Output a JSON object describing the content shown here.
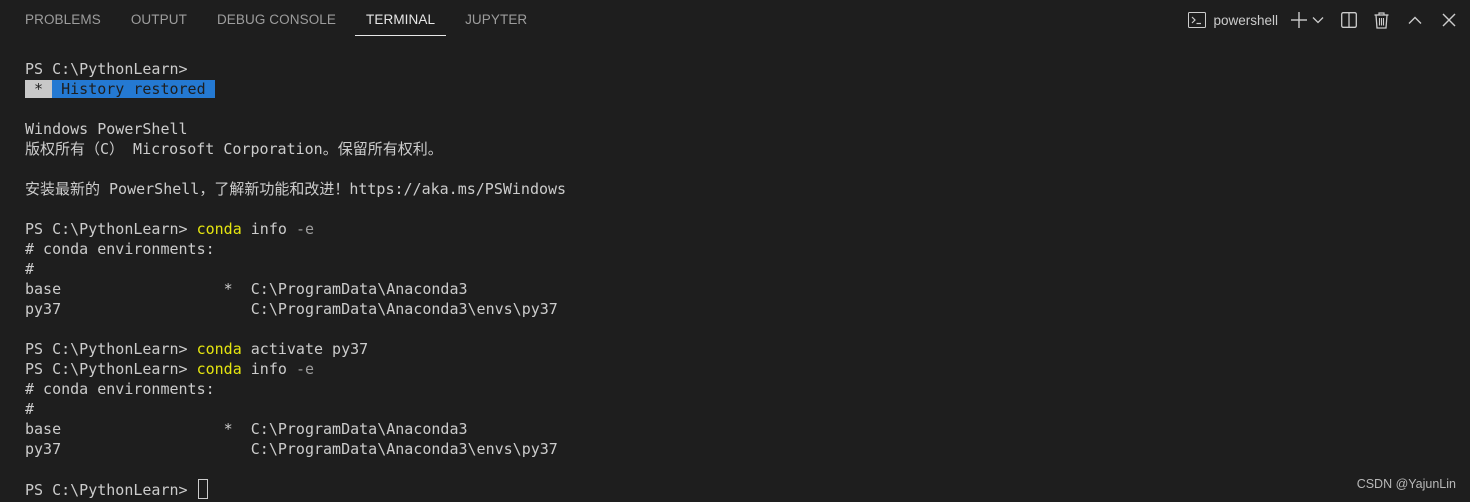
{
  "panel": {
    "tabs": [
      {
        "label": "PROBLEMS",
        "active": false
      },
      {
        "label": "OUTPUT",
        "active": false
      },
      {
        "label": "DEBUG CONSOLE",
        "active": false
      },
      {
        "label": "TERMINAL",
        "active": true
      },
      {
        "label": "JUPYTER",
        "active": false
      }
    ],
    "actions": {
      "shell_name": "powershell",
      "icons": [
        "terminal-icon",
        "plus-icon",
        "chevron-down-icon",
        "split-icon",
        "trash-icon",
        "chevron-up-icon",
        "close-icon"
      ]
    }
  },
  "terminal": {
    "lines": {
      "l01": {
        "prompt": "PS C:\\PythonLearn>"
      },
      "l02": {
        "star": " * ",
        "message": " History restored "
      },
      "l04": {
        "text": "Windows PowerShell"
      },
      "l05": {
        "text": "版权所有（C） Microsoft Corporation。保留所有权利。"
      },
      "l07": {
        "text": "安装最新的 PowerShell，了解新功能和改进！https://aka.ms/PSWindows"
      },
      "l09": {
        "prompt": "PS C:\\PythonLearn> ",
        "cmd": "conda",
        "args": " info ",
        "flag": "-e"
      },
      "l10": {
        "text": "# conda environments:"
      },
      "l11": {
        "text": "#"
      },
      "l12": {
        "text": "base                  *  C:\\ProgramData\\Anaconda3"
      },
      "l13": {
        "text": "py37                     C:\\ProgramData\\Anaconda3\\envs\\py37"
      },
      "l15": {
        "prompt": "PS C:\\PythonLearn> ",
        "cmd": "conda",
        "args": " activate py37"
      },
      "l16": {
        "prompt": "PS C:\\PythonLearn> ",
        "cmd": "conda",
        "args": " info ",
        "flag": "-e"
      },
      "l17": {
        "text": "# conda environments:"
      },
      "l18": {
        "text": "#"
      },
      "l19": {
        "text": "base                  *  C:\\ProgramData\\Anaconda3"
      },
      "l20": {
        "text": "py37                     C:\\ProgramData\\Anaconda3\\envs\\py37"
      },
      "l22": {
        "prompt": "PS C:\\PythonLearn> "
      }
    }
  },
  "watermark": "CSDN @YajunLin",
  "colors": {
    "background": "#1e1e1e",
    "command_yellow": "#e5e510",
    "highlight_blue": "#2479d2",
    "text": "#cccccc"
  }
}
